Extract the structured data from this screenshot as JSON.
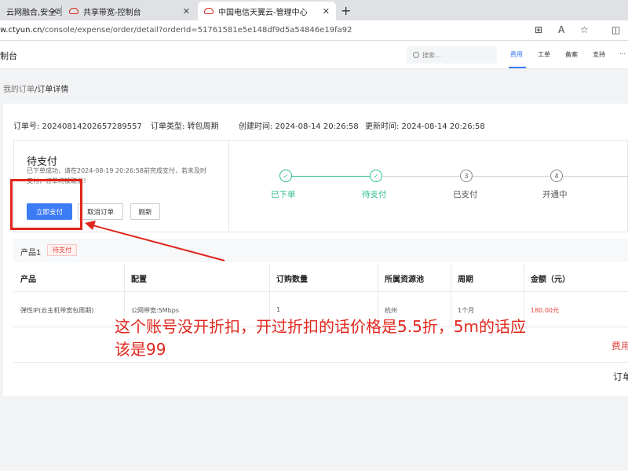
{
  "browser": {
    "tabs": [
      {
        "label": "云网融合,安全可"
      },
      {
        "label": "共享带宽-控制台"
      },
      {
        "label": "中国电信天翼云-管理中心"
      }
    ],
    "new_tab": "+",
    "url_host": "w.ctyun.cn",
    "url_path": "/console/expense/order/detail?orderId=51761581e5e148df9d5a54846e19fa92"
  },
  "console": {
    "brand": "制台",
    "search_placeholder": "搜索...",
    "nav": [
      "费用",
      "工单",
      "备案",
      "支持"
    ],
    "active_nav": "费用"
  },
  "breadcrumb": {
    "parent": "我的订单",
    "separator": "/",
    "current": "订单详情"
  },
  "order_meta": {
    "order_no": "订单号: 20240814202657289557",
    "order_type": "订单类型: 转包周期",
    "created": "创建时间: 2024-08-14 20:26:58",
    "updated": "更新时间: 2024-08-14 20:26:58"
  },
  "status": {
    "title": "待支付",
    "description_line1": "已下单成功，请在2024-08-19 20:26:58前完成支付，若未及时",
    "description_line2": "支付，订单将被取消！"
  },
  "actions": {
    "pay": "立即支付",
    "cancel": "取消订单",
    "refresh": "刷新"
  },
  "steps": [
    {
      "num": "✓",
      "label": "已下单",
      "done": true
    },
    {
      "num": "✓",
      "label": "待支付",
      "done": true
    },
    {
      "num": "3",
      "label": "已支付",
      "done": false
    },
    {
      "num": "4",
      "label": "开通中",
      "done": false
    }
  ],
  "product": {
    "name": "产品1",
    "status": "待支付"
  },
  "table": {
    "headers": [
      "产品",
      "配置",
      "订购数量",
      "所属资源池",
      "周期",
      "金额（元）"
    ],
    "row": [
      "弹性IP(云主机带宽包周期)",
      "公网带宽:5Mbps",
      "1",
      "杭州",
      "1个月",
      "180.00元"
    ]
  },
  "summary": {
    "fee_label": "费用",
    "order_label": "订单"
  },
  "annotation": {
    "line1": "这个账号没开折扣，开过折扣的话价格是5.5折，5m的话应",
    "line2": "该是99"
  },
  "colors": {
    "accent": "#3b7cf5",
    "success": "#2dbd8a",
    "danger": "#e0261c"
  }
}
